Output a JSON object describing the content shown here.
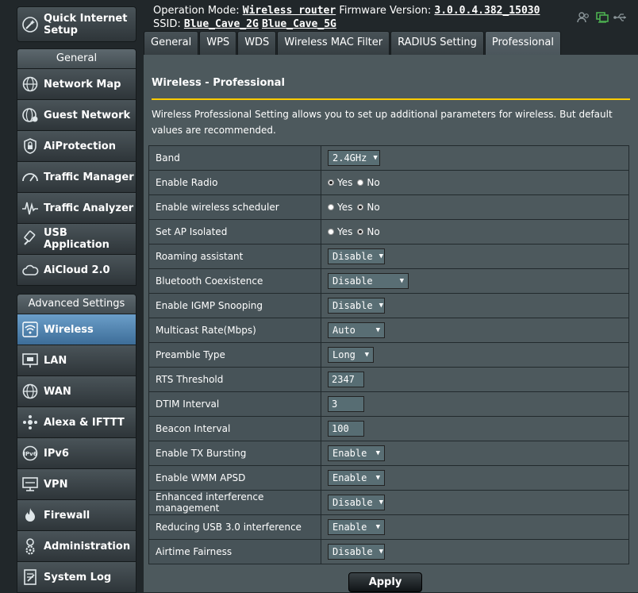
{
  "header": {
    "operation_mode_label": "Operation Mode:",
    "operation_mode_value": "Wireless router",
    "firmware_label": "Firmware Version:",
    "firmware_value": "3.0.0.4.382_15030",
    "ssid_label": "SSID:",
    "ssid_2g": "Blue_Cave_2G",
    "ssid_5g": "Blue_Cave_5G",
    "icons": [
      "user-clients-icon",
      "network-status-icon",
      "usb-status-icon"
    ]
  },
  "sidebar": {
    "quick_setup": {
      "label": "Quick Internet Setup",
      "icon": "magic-wand-icon"
    },
    "general": {
      "title": "General",
      "items": [
        {
          "label": "Network Map",
          "icon": "globe-icon"
        },
        {
          "label": "Guest Network",
          "icon": "guest-globe-icon"
        },
        {
          "label": "AiProtection",
          "icon": "lock-shield-icon"
        },
        {
          "label": "Traffic Manager",
          "icon": "speedometer-icon"
        },
        {
          "label": "Traffic Analyzer",
          "icon": "waveform-icon"
        },
        {
          "label": "USB Application",
          "icon": "usb-icon"
        },
        {
          "label": "AiCloud 2.0",
          "icon": "cloud-icon"
        }
      ]
    },
    "advanced": {
      "title": "Advanced Settings",
      "items": [
        {
          "label": "Wireless",
          "icon": "wifi-icon",
          "active": true
        },
        {
          "label": "LAN",
          "icon": "lan-icon"
        },
        {
          "label": "WAN",
          "icon": "globe-icon"
        },
        {
          "label": "Alexa & IFTTT",
          "icon": "smart-home-icon"
        },
        {
          "label": "IPv6",
          "icon": "ipv6-icon"
        },
        {
          "label": "VPN",
          "icon": "vpn-icon"
        },
        {
          "label": "Firewall",
          "icon": "fire-icon"
        },
        {
          "label": "Administration",
          "icon": "person-gear-icon"
        },
        {
          "label": "System Log",
          "icon": "document-icon"
        }
      ]
    }
  },
  "tabs": [
    {
      "label": "General"
    },
    {
      "label": "WPS"
    },
    {
      "label": "WDS"
    },
    {
      "label": "Wireless MAC Filter"
    },
    {
      "label": "RADIUS Setting"
    },
    {
      "label": "Professional",
      "active": true
    }
  ],
  "main": {
    "title": "Wireless - Professional",
    "description": "Wireless Professional Setting allows you to set up additional parameters for wireless. But default values are recommended.",
    "settings": [
      {
        "label": "Band",
        "type": "select",
        "value": "2.4GHz"
      },
      {
        "label": "Enable Radio",
        "type": "radio",
        "options": [
          "Yes",
          "No"
        ],
        "selected": "Yes"
      },
      {
        "label": "Enable wireless scheduler",
        "type": "radio",
        "options": [
          "Yes",
          "No"
        ],
        "selected": "No"
      },
      {
        "label": "Set AP Isolated",
        "type": "radio",
        "options": [
          "Yes",
          "No"
        ],
        "selected": "No"
      },
      {
        "label": "Roaming assistant",
        "type": "select",
        "value": "Disable"
      },
      {
        "label": "Bluetooth Coexistence",
        "type": "select",
        "value": "Disable"
      },
      {
        "label": "Enable IGMP Snooping",
        "type": "select",
        "value": "Disable"
      },
      {
        "label": "Multicast Rate(Mbps)",
        "type": "select",
        "value": "Auto"
      },
      {
        "label": "Preamble Type",
        "type": "select",
        "value": "Long"
      },
      {
        "label": "RTS Threshold",
        "type": "text",
        "value": "2347"
      },
      {
        "label": "DTIM Interval",
        "type": "text",
        "value": "3"
      },
      {
        "label": "Beacon Interval",
        "type": "text",
        "value": "100"
      },
      {
        "label": "Enable TX Bursting",
        "type": "select",
        "value": "Enable"
      },
      {
        "label": "Enable WMM APSD",
        "type": "select",
        "value": "Enable"
      },
      {
        "label": "Enhanced interference management",
        "type": "select",
        "value": "Disable"
      },
      {
        "label": "Reducing USB 3.0 interference",
        "type": "select",
        "value": "Enable"
      },
      {
        "label": "Airtime Fairness",
        "type": "select",
        "value": "Disable"
      }
    ],
    "apply_label": "Apply"
  },
  "colors": {
    "accent_divider": "#ffcc00",
    "active_menu": "#4f86b8",
    "content_bg": "#4d595d"
  }
}
